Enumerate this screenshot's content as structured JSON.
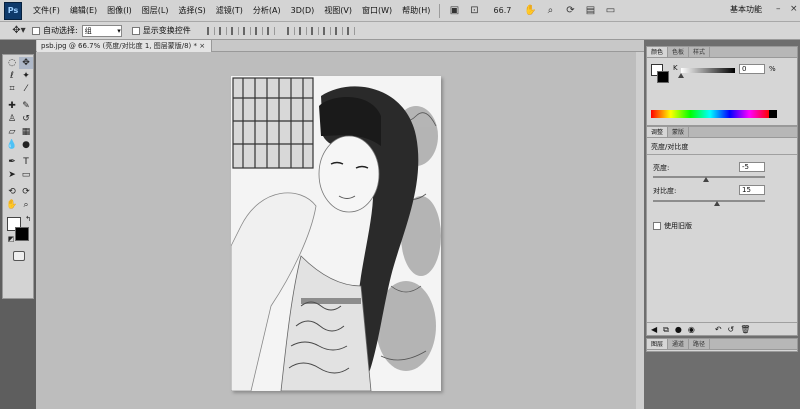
{
  "app": {
    "logo": "Ps"
  },
  "menu": [
    "文件(F)",
    "编辑(E)",
    "图像(I)",
    "图层(L)",
    "选择(S)",
    "滤镜(T)",
    "分析(A)",
    "3D(D)",
    "视图(V)",
    "窗口(W)",
    "帮助(H)"
  ],
  "toolbar": {
    "zoom": "66.7",
    "workspace": "基本功能"
  },
  "options": {
    "auto_select_label": "自动选择:",
    "auto_select_value": "组",
    "transform_label": "显示变换控件"
  },
  "document": {
    "tab_label": "psb.jpg @ 66.7% (亮度/对比度 1, 图层蒙版/8) *"
  },
  "color_panel": {
    "tabs": [
      "颜色",
      "色板",
      "样式"
    ],
    "k_label": "K",
    "k_value": "0",
    "unit": "%"
  },
  "adjust_panel": {
    "tabs": [
      "调整",
      "蒙版"
    ],
    "title": "亮度/对比度",
    "brightness_label": "亮度:",
    "brightness_value": "-5",
    "contrast_label": "对比度:",
    "contrast_value": "15",
    "legacy_label": "使用旧版"
  },
  "layers_panel": {
    "tabs": [
      "图层",
      "通道",
      "路径"
    ]
  }
}
